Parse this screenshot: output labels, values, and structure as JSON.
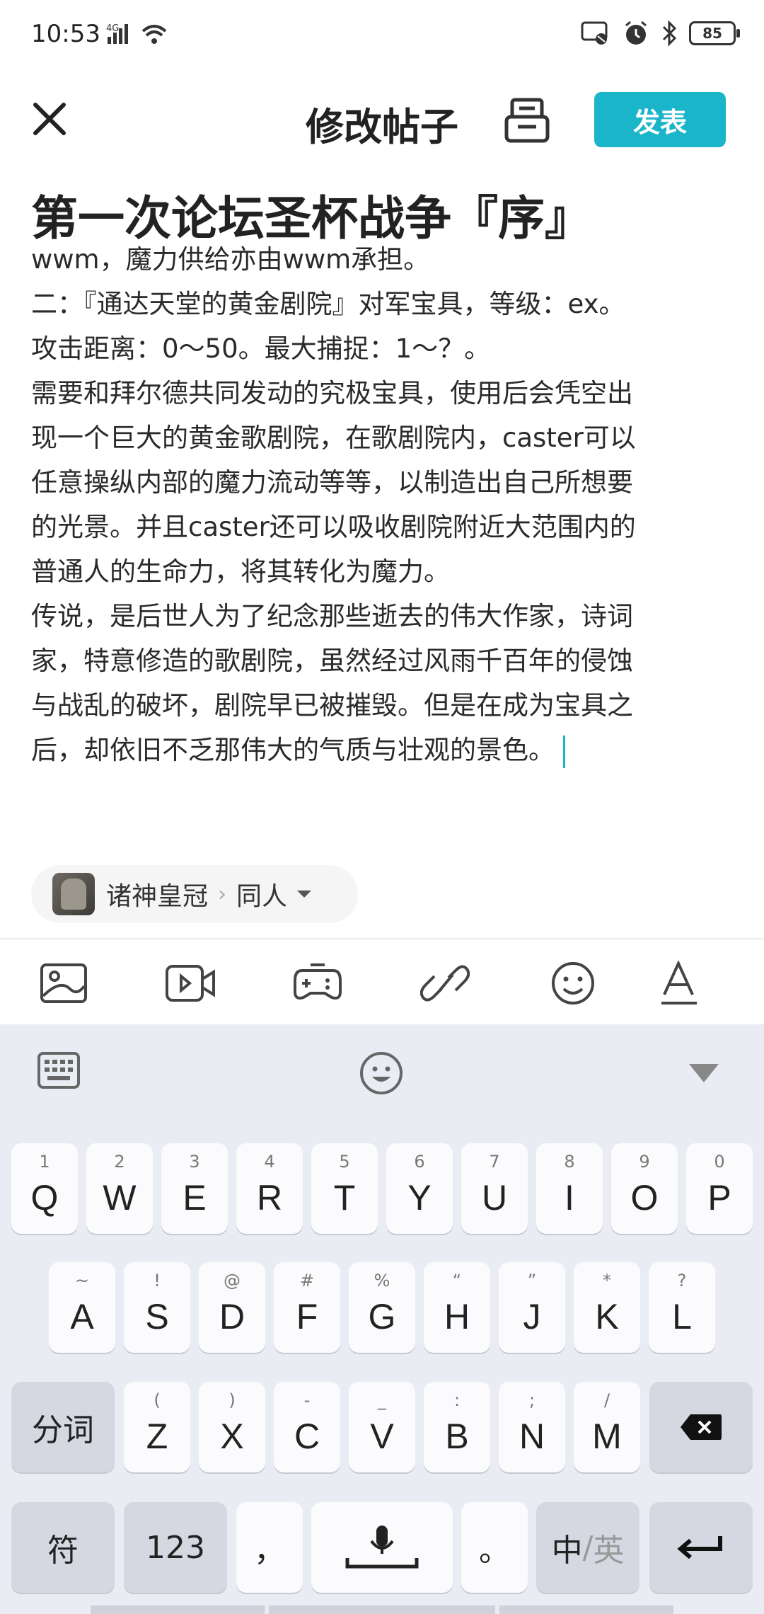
{
  "status": {
    "time": "10:53",
    "network": "4G",
    "battery": "85"
  },
  "header": {
    "title": "修改帖子",
    "publish_label": "发表"
  },
  "post": {
    "title": "第一次论坛圣杯战争『序』",
    "lines": [
      "wwm，魔力供给亦由wwm承担。",
      "二：『通达天堂的黄金剧院』对军宝具，等级：ex。",
      "攻击距离：0～50。最大捕捉：1～？。",
      "需要和拜尔德共同发动的究极宝具，使用后会凭空出",
      "现一个巨大的黄金歌剧院，在歌剧院内，caster可以",
      "任意操纵内部的魔力流动等等，以制造出自己所想要",
      "的光景。并且caster还可以吸收剧院附近大范围内的",
      "普通人的生命力，将其转化为魔力。",
      "传说，是后世人为了纪念那些逝去的伟大作家，诗词",
      "家，特意修造的歌剧院，虽然经过风雨千百年的侵蚀",
      "与战乱的破坏，剧院早已被摧毁。但是在成为宝具之",
      "后，却依旧不乏那伟大的气质与壮观的景色。"
    ]
  },
  "category": {
    "forum": "诸神皇冠",
    "separator": "›",
    "subforum": "同人"
  },
  "toolbar": {
    "icons": [
      "image-icon",
      "video-icon",
      "game-icon",
      "link-icon",
      "emoji-icon",
      "text-format-icon"
    ]
  },
  "keyboard": {
    "row1": [
      {
        "key": "Q",
        "hint": "1"
      },
      {
        "key": "W",
        "hint": "2"
      },
      {
        "key": "E",
        "hint": "3"
      },
      {
        "key": "R",
        "hint": "4"
      },
      {
        "key": "T",
        "hint": "5"
      },
      {
        "key": "Y",
        "hint": "6"
      },
      {
        "key": "U",
        "hint": "7"
      },
      {
        "key": "I",
        "hint": "8"
      },
      {
        "key": "O",
        "hint": "9"
      },
      {
        "key": "P",
        "hint": "0"
      }
    ],
    "row2": [
      {
        "key": "A",
        "hint": "~"
      },
      {
        "key": "S",
        "hint": "!"
      },
      {
        "key": "D",
        "hint": "@"
      },
      {
        "key": "F",
        "hint": "#"
      },
      {
        "key": "G",
        "hint": "%"
      },
      {
        "key": "H",
        "hint": "“"
      },
      {
        "key": "J",
        "hint": "”"
      },
      {
        "key": "K",
        "hint": "*"
      },
      {
        "key": "L",
        "hint": "?"
      }
    ],
    "row3": [
      {
        "key": "Z",
        "hint": "("
      },
      {
        "key": "X",
        "hint": ")"
      },
      {
        "key": "C",
        "hint": "-"
      },
      {
        "key": "V",
        "hint": "_"
      },
      {
        "key": "B",
        "hint": ":"
      },
      {
        "key": "N",
        "hint": ";"
      },
      {
        "key": "M",
        "hint": "/"
      }
    ],
    "segment_label": "分词",
    "symbol_label": "符",
    "number_label": "123",
    "comma_label": "，",
    "period_label": "。",
    "lang_zh": "中",
    "lang_sep": "/",
    "lang_en": "英"
  }
}
